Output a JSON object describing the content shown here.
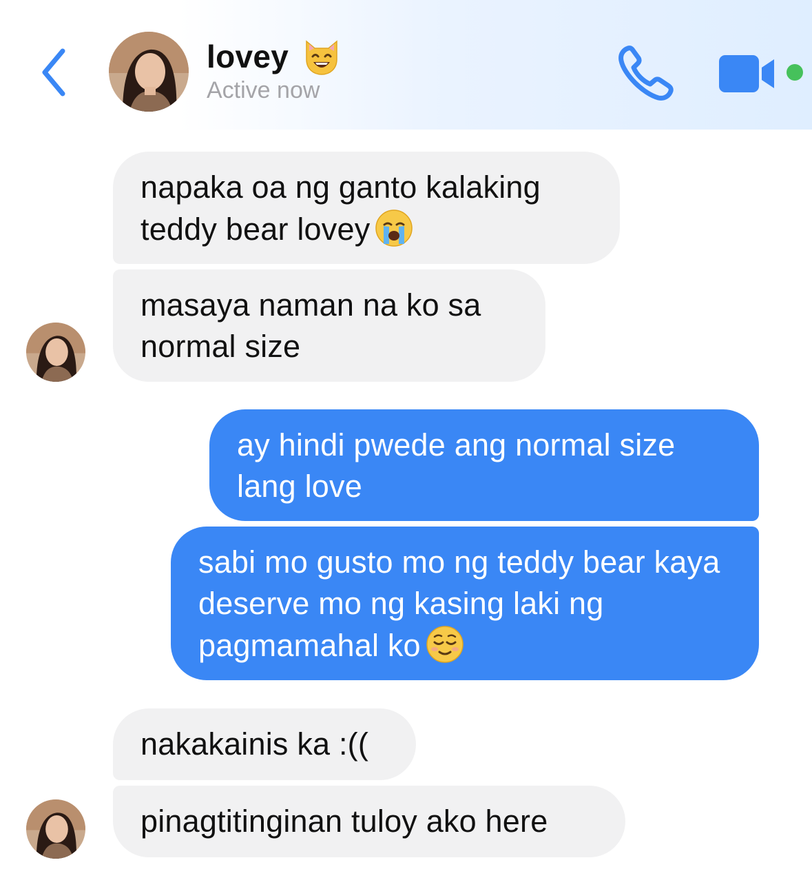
{
  "header": {
    "contact_name": "lovey",
    "status": "Active now",
    "icons": {
      "back": "chevron-left-icon",
      "call": "phone-icon",
      "video": "video-camera-icon",
      "name_emoji": "grinning-cat-emoji"
    },
    "accent_color": "#3a87f5",
    "online_color": "#46c15b"
  },
  "messages": [
    {
      "sender": "contact",
      "text": "napaka oa ng ganto kalaking teddy bear lovey",
      "emoji": "loudly-crying-face"
    },
    {
      "sender": "contact",
      "text": "masaya naman na ko sa normal size"
    },
    {
      "sender": "me",
      "text": "ay hindi pwede ang normal size lang love"
    },
    {
      "sender": "me",
      "text": "sabi mo gusto mo ng teddy bear kaya deserve mo ng kasing laki ng pagmamahal ko",
      "emoji": "relieved-face"
    },
    {
      "sender": "contact",
      "text": "nakakainis ka :(("
    },
    {
      "sender": "contact",
      "text": "pinagtitinginan tuloy ako here"
    }
  ],
  "colors": {
    "incoming_bubble": "#f1f1f2",
    "outgoing_bubble": "#3a87f5"
  }
}
